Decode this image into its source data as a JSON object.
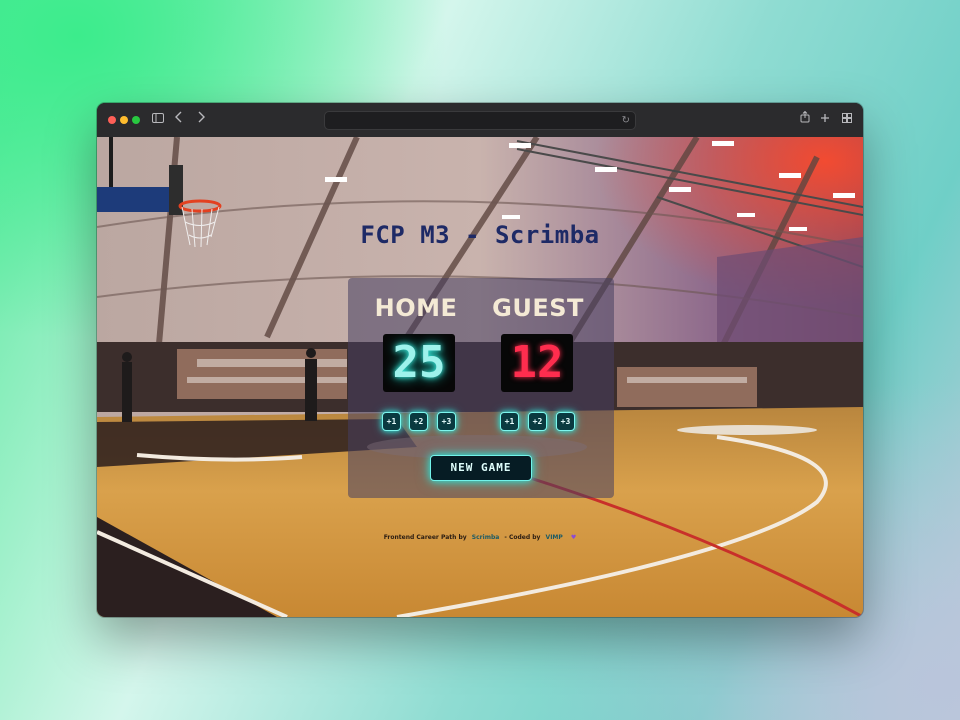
{
  "browser": {
    "nav_back_icon": "chevron-left-icon",
    "nav_forward_icon": "chevron-right-icon",
    "sidebar_icon": "sidebar-icon",
    "reload_icon": "reload-icon",
    "share_icon": "share-icon",
    "new_tab_icon": "plus-icon",
    "tabs_icon": "tab-overview-icon"
  },
  "page": {
    "title": "FCP M3 - Scrimba"
  },
  "scoreboard": {
    "home": {
      "label": "HOME",
      "score": "25",
      "color": "#3ff5e6"
    },
    "guest": {
      "label": "GUEST",
      "score": "12",
      "color": "#ff2b4c"
    },
    "home_buttons": [
      "+1",
      "+2",
      "+3"
    ],
    "guest_buttons": [
      "+1",
      "+2",
      "+3"
    ],
    "new_game_label": "NEW GAME"
  },
  "footer": {
    "prefix": "Frontend Career Path by",
    "scrimba_link": "Scrimba",
    "middle": "- Coded by",
    "author_link": "VIMP",
    "heart_icon": "heart-icon"
  },
  "colors": {
    "neon_accent": "#2ee3d8",
    "title_color": "#1e2a66"
  }
}
